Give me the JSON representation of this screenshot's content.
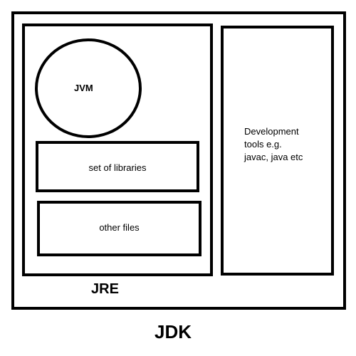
{
  "jvm": {
    "label": "JVM"
  },
  "libraries": {
    "label": "set of libraries"
  },
  "other_files": {
    "label": "other files"
  },
  "jre": {
    "label": "JRE"
  },
  "dev_tools": {
    "lines": [
      "Development",
      "tools e.g.",
      "javac, java etc"
    ]
  },
  "jdk": {
    "label": "JDK"
  }
}
